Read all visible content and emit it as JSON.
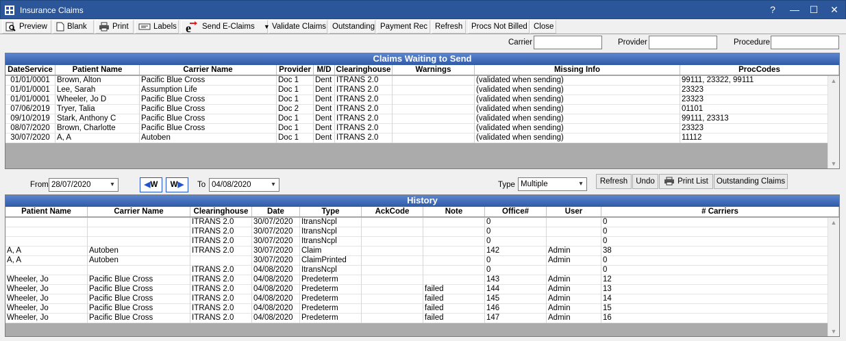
{
  "window": {
    "title": "Insurance Claims",
    "help": "?",
    "minimize": "—",
    "maximize": "☐",
    "close": "✕"
  },
  "toolbar": {
    "preview": "Preview",
    "blank": "Blank",
    "print": "Print",
    "labels": "Labels",
    "send": "Send E-Claims",
    "validate": "Validate Claims",
    "outstanding": "Outstanding",
    "payment": "Payment Rec",
    "refresh": "Refresh",
    "procs": "Procs Not Billed",
    "close": "Close"
  },
  "filters": {
    "carrier_label": "Carrier",
    "carrier_value": "",
    "provider_label": "Provider",
    "provider_value": "",
    "procedure_label": "Procedure",
    "procedure_value": ""
  },
  "waiting": {
    "title": "Claims Waiting to Send",
    "columns": [
      "DateService",
      "Patient Name",
      "Carrier Name",
      "Provider",
      "M/D",
      "Clearinghouse",
      "Warnings",
      "Missing Info",
      "ProcCodes"
    ],
    "rows": [
      [
        "01/01/0001",
        "Brown, Alton",
        "Pacific Blue Cross",
        "Doc 1",
        "Dent",
        "ITRANS 2.0",
        "",
        "(validated when sending)",
        "99111, 23322, 99111"
      ],
      [
        "01/01/0001",
        "Lee, Sarah",
        "Assumption Life",
        "Doc 1",
        "Dent",
        "ITRANS 2.0",
        "",
        "(validated when sending)",
        "23323"
      ],
      [
        "01/01/0001",
        "Wheeler, Jo D",
        "Pacific Blue Cross",
        "Doc 1",
        "Dent",
        "ITRANS 2.0",
        "",
        "(validated when sending)",
        "23323"
      ],
      [
        "07/06/2019",
        "Tryer, Talia",
        "Pacific Blue Cross",
        "Doc 2",
        "Dent",
        "ITRANS 2.0",
        "",
        "(validated when sending)",
        "01101"
      ],
      [
        "09/10/2019",
        "Stark, Anthony C",
        "Pacific Blue Cross",
        "Doc 1",
        "Dent",
        "ITRANS 2.0",
        "",
        "(validated when sending)",
        "99111, 23313"
      ],
      [
        "08/07/2020",
        "Brown, Charlotte",
        "Pacific Blue Cross",
        "Doc 1",
        "Dent",
        "ITRANS 2.0",
        "",
        "(validated when sending)",
        "23323"
      ],
      [
        "30/07/2020",
        "A, A",
        "Autoben",
        "Doc 1",
        "Dent",
        "ITRANS 2.0",
        "",
        "(validated when sending)",
        "11112"
      ]
    ]
  },
  "range": {
    "from_label": "From",
    "from_value": "28/07/2020",
    "week_back": "W",
    "week_fwd": "W",
    "to_label": "To",
    "to_value": "04/08/2020",
    "type_label": "Type",
    "type_value": "Multiple"
  },
  "history_buttons": {
    "refresh": "Refresh",
    "undo": "Undo",
    "print_list": "Print List",
    "outstanding": "Outstanding Claims"
  },
  "history": {
    "title": "History",
    "columns": [
      "Patient Name",
      "Carrier Name",
      "Clearinghouse",
      "Date",
      "Type",
      "AckCode",
      "Note",
      "Office#",
      "User",
      "# Carriers"
    ],
    "rows": [
      [
        "",
        "",
        "ITRANS 2.0",
        "30/07/2020",
        "ItransNcpl",
        "",
        "",
        "0",
        "",
        "0"
      ],
      [
        "",
        "",
        "ITRANS 2.0",
        "30/07/2020",
        "ItransNcpl",
        "",
        "",
        "0",
        "",
        "0"
      ],
      [
        "",
        "",
        "ITRANS 2.0",
        "30/07/2020",
        "ItransNcpl",
        "",
        "",
        "0",
        "",
        "0"
      ],
      [
        "A, A",
        "Autoben",
        "ITRANS 2.0",
        "30/07/2020",
        "Claim",
        "",
        "",
        "142",
        "Admin",
        "38"
      ],
      [
        "A, A",
        "Autoben",
        "",
        "30/07/2020",
        "ClaimPrinted",
        "",
        "",
        "0",
        "Admin",
        "0"
      ],
      [
        "",
        "",
        "ITRANS 2.0",
        "04/08/2020",
        "ItransNcpl",
        "",
        "",
        "0",
        "",
        "0"
      ],
      [
        "Wheeler, Jo",
        "Pacific Blue Cross",
        "ITRANS 2.0",
        "04/08/2020",
        "Predeterm",
        "",
        "",
        "143",
        "Admin",
        "12"
      ],
      [
        "Wheeler, Jo",
        "Pacific Blue Cross",
        "ITRANS 2.0",
        "04/08/2020",
        "Predeterm",
        "",
        "failed",
        "144",
        "Admin",
        "13"
      ],
      [
        "Wheeler, Jo",
        "Pacific Blue Cross",
        "ITRANS 2.0",
        "04/08/2020",
        "Predeterm",
        "",
        "failed",
        "145",
        "Admin",
        "14"
      ],
      [
        "Wheeler, Jo",
        "Pacific Blue Cross",
        "ITRANS 2.0",
        "04/08/2020",
        "Predeterm",
        "",
        "failed",
        "146",
        "Admin",
        "15"
      ],
      [
        "Wheeler, Jo",
        "Pacific Blue Cross",
        "ITRANS 2.0",
        "04/08/2020",
        "Predeterm",
        "",
        "failed",
        "147",
        "Admin",
        "16"
      ]
    ]
  }
}
